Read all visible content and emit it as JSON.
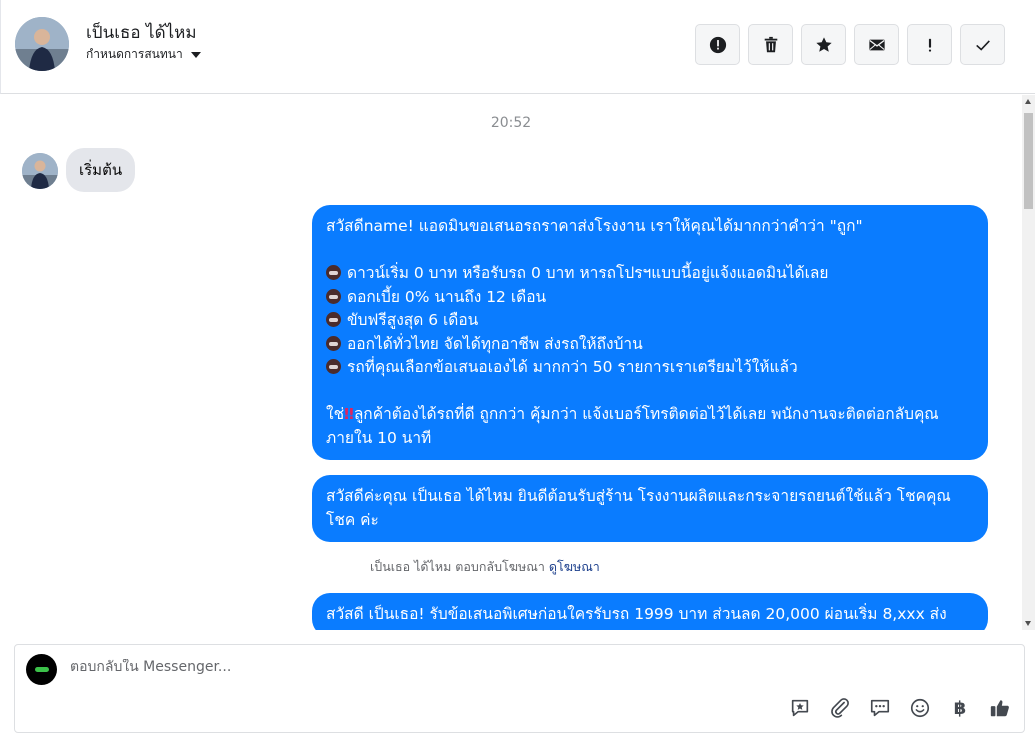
{
  "header": {
    "contact_name": "เป็นเธอ ได้ไหม",
    "assign_label": "กำหนดการสนทนา"
  },
  "actions": [
    {
      "name": "spam-button",
      "icon": "alert-circle-icon"
    },
    {
      "name": "delete-button",
      "icon": "trash-icon"
    },
    {
      "name": "star-button",
      "icon": "star-icon"
    },
    {
      "name": "mark-unread-button",
      "icon": "envelope-icon"
    },
    {
      "name": "follow-up-button",
      "icon": "exclamation-icon"
    },
    {
      "name": "mark-done-button",
      "icon": "check-icon"
    }
  ],
  "conversation": {
    "timestamp": "20:52",
    "incoming": {
      "text": "เริ่มต้น"
    },
    "bubble1": {
      "line1": "สวัสดีname! แอดมินขอเสนอรถราคาส่งโรงงาน เราให้คุณได้มากกว่าคำว่า \"ถูก\"",
      "item1": "ดาวน์เริ่ม 0 บาท หรือรับรถ 0 บาท หารถโปรฯแบบนี้อยู่แจ้งแอดมินได้เลย",
      "item2": "ดอกเบี้ย 0% นานถึง 12 เดือน",
      "item3": "ขับฟรีสูงสุด 6 เดือน",
      "item4": "ออกได้ทั่วไทย จัดได้ทุกอาชีพ ส่งรถให้ถึงบ้าน",
      "item5": "รถที่คุณเลือกข้อเสนอเองได้ มากกว่า 50 รายการเราเตรียมไว้ให้แล้ว",
      "closing_a": "ใช่",
      "closing_b": "ลูกค้าต้องได้รถที่ดี ถูกกว่า คุ้มกว่า แจ้งเบอร์โทรติดต่อไว้ได้เลย พนักงานจะติดต่อกลับคุณภายใน 10 นาที"
    },
    "bubble2": "สวัสดีค่ะคุณ เป็นเธอ ได้ไหม ยินดีต้อนรับสู่ร้าน โรงงานผลิตและกระจายรถยนต์ใช้แล้ว โชคคุณโชค ค่ะ",
    "reply_note": "เป็นเธอ ได้ไหม ตอบกลับโฆษณา",
    "reply_link": "ดูโฆษณา",
    "bubble3": "สวัสดี เป็นเธอ! รับข้อเสนอพิเศษก่อนใครรับรถ 1999 บาท ส่วนลด 20,000 ผ่อนเริ่ม 8,xxx ส่ง"
  },
  "composer": {
    "placeholder": "ตอบกลับใน Messenger...",
    "tools": [
      "saved-reply-icon",
      "attachment-icon",
      "chat-bubble-icon",
      "emoji-icon",
      "baht-icon",
      "like-icon"
    ],
    "baht_symbol": "฿"
  },
  "colors": {
    "outgoing_bubble": "#0a7cff",
    "incoming_bubble": "#e4e6eb"
  }
}
